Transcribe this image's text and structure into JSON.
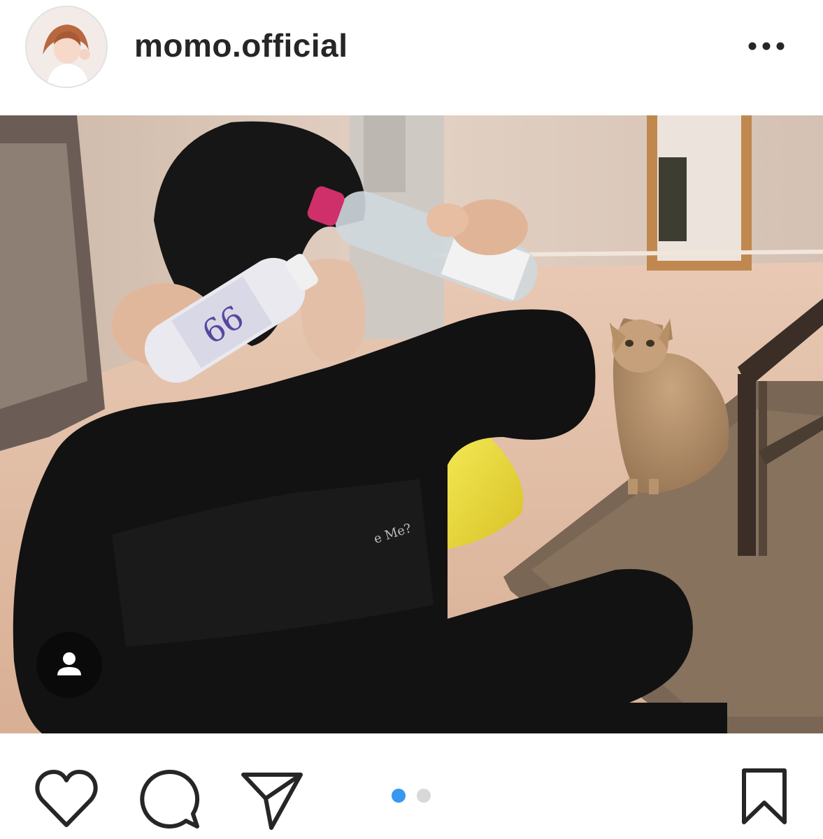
{
  "post": {
    "username": "momo.official",
    "photo_caption_text": "e Me?"
  },
  "icons": {
    "avatar": "profile-avatar",
    "more": "more-options-icon",
    "tag": "user-tag-icon",
    "like": "heart-icon",
    "comment": "comment-bubble-icon",
    "share": "paper-plane-icon",
    "save": "bookmark-icon"
  },
  "carousel": {
    "count": 2,
    "active_index": 0,
    "active_color": "#3897f0",
    "inactive_color": "#d8d8d8"
  },
  "colors": {
    "text": "#262626",
    "icon": "#262626",
    "background": "#ffffff"
  }
}
